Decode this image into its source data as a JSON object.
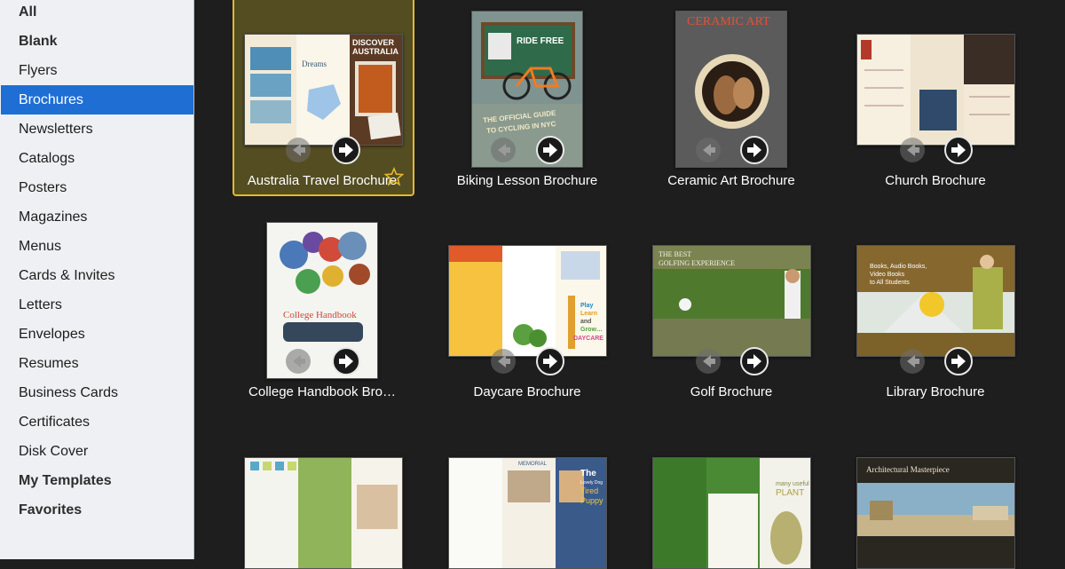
{
  "sidebar": {
    "items": [
      {
        "label": "All",
        "bold": true
      },
      {
        "label": "Blank",
        "bold": true
      },
      {
        "label": "Flyers"
      },
      {
        "label": "Brochures",
        "selected": true
      },
      {
        "label": "Newsletters"
      },
      {
        "label": "Catalogs"
      },
      {
        "label": "Posters"
      },
      {
        "label": "Magazines"
      },
      {
        "label": "Menus"
      },
      {
        "label": "Cards & Invites"
      },
      {
        "label": "Letters"
      },
      {
        "label": "Envelopes"
      },
      {
        "label": "Resumes"
      },
      {
        "label": "Business Cards"
      },
      {
        "label": "Certificates"
      },
      {
        "label": "Disk Cover"
      },
      {
        "label": "My Templates",
        "bold": true
      },
      {
        "label": "Favorites",
        "bold": true
      }
    ]
  },
  "templates": [
    {
      "label": "Australia Travel Brochure",
      "selected": true,
      "favorite": true,
      "thumb_text": [
        "DISCOVER",
        "AUSTRALIA",
        "Dreams"
      ]
    },
    {
      "label": "Biking Lesson Brochure",
      "thumb_text": [
        "RIDE FREE",
        "THE OFFICIAL GUIDE",
        "TO CYCLING IN NYC"
      ]
    },
    {
      "label": "Ceramic Art Brochure",
      "thumb_text": [
        "CERAMIC ART"
      ]
    },
    {
      "label": "Church Brochure",
      "thumb_text": []
    },
    {
      "label": "College Handbook Bro…",
      "thumb_text": [
        "College Handbook"
      ]
    },
    {
      "label": "Daycare Brochure",
      "thumb_text": [
        "Play",
        "Learn",
        "and",
        "Grow…",
        "DAYCARE"
      ]
    },
    {
      "label": "Golf Brochure",
      "thumb_text": [
        "THE BEST",
        "GOLFING EXPERIENCE"
      ]
    },
    {
      "label": "Library Brochure",
      "thumb_text": [
        "Books, Audio Books,",
        "Video Books",
        "to All Students"
      ]
    },
    {
      "label": "",
      "thumb_text": []
    },
    {
      "label": "",
      "thumb_text": [
        "The",
        "Lovely Dog",
        "Tired",
        "Puppy",
        "MEMORIAL"
      ]
    },
    {
      "label": "",
      "thumb_text": [
        "many useful",
        "PLANT"
      ]
    },
    {
      "label": "",
      "thumb_text": [
        "Architectural Masterpiece"
      ]
    }
  ],
  "colors": {
    "sidebar_bg": "#eef0f3",
    "selection_blue": "#1f6ed4",
    "main_bg": "#1e1e1e",
    "selected_tile_border": "#e3b92c",
    "selected_tile_bg": "#544d22"
  },
  "icons": {
    "prev": "arrow-left-circle-icon",
    "next": "arrow-right-circle-icon",
    "favorite": "star-outline-icon"
  }
}
